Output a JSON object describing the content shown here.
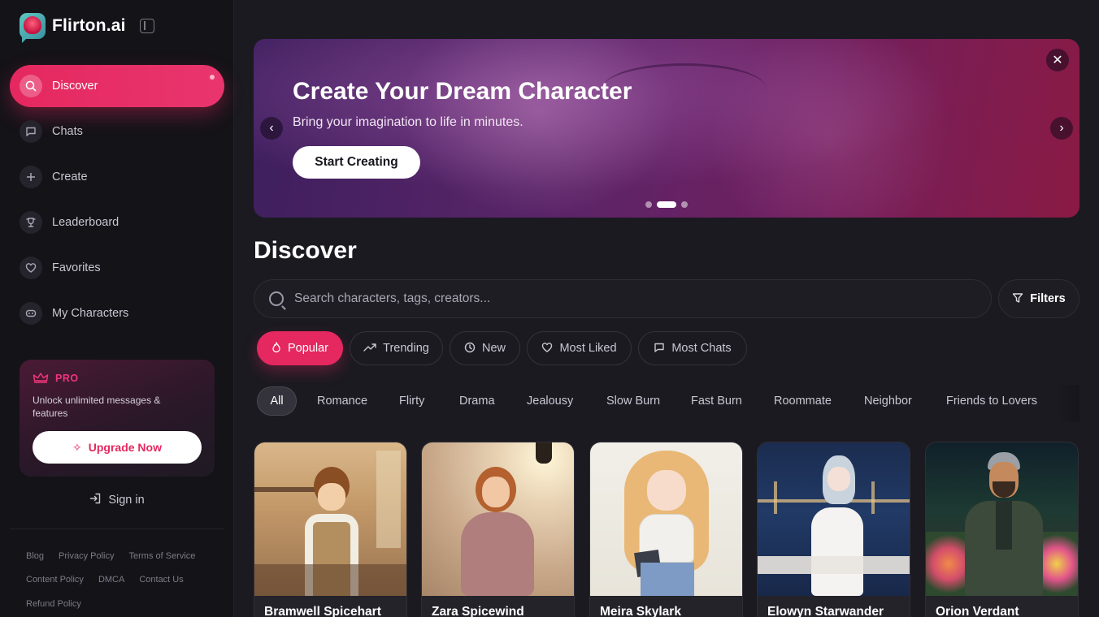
{
  "brand": {
    "name": "Flirton.ai"
  },
  "sidebar": {
    "items": [
      {
        "label": "Discover",
        "icon": "search-icon"
      },
      {
        "label": "Chats",
        "icon": "chat-icon"
      },
      {
        "label": "Create",
        "icon": "plus-icon"
      },
      {
        "label": "Leaderboard",
        "icon": "trophy-icon"
      },
      {
        "label": "Favorites",
        "icon": "heart-icon"
      },
      {
        "label": "My Characters",
        "icon": "mask-icon"
      }
    ],
    "pro": {
      "badge": "PRO",
      "text": "Unlock unlimited messages & features",
      "button": "Upgrade Now"
    },
    "signin": "Sign in",
    "footer_links": [
      [
        "Blog",
        "Privacy Policy",
        "Terms of Service"
      ],
      [
        "Content Policy",
        "DMCA",
        "Contact Us"
      ],
      [
        "Refund Policy"
      ]
    ]
  },
  "hero": {
    "title": "Create Your Dream Character",
    "subtitle": "Bring your imagination to life in minutes.",
    "button": "Start Creating",
    "slides": 3,
    "active_slide": 2
  },
  "discover": {
    "title": "Discover",
    "search_placeholder": "Search characters, tags, creators...",
    "filters_label": "Filters",
    "sort_tabs": [
      {
        "label": "Popular",
        "icon": "flame-icon"
      },
      {
        "label": "Trending",
        "icon": "trending-icon"
      },
      {
        "label": "New",
        "icon": "clock-icon"
      },
      {
        "label": "Most Liked",
        "icon": "heart-icon"
      },
      {
        "label": "Most Chats",
        "icon": "chat-icon"
      }
    ],
    "active_sort": "Popular",
    "tags": [
      "All",
      "Romance",
      "Flirty",
      "Drama",
      "Jealousy",
      "Slow Burn",
      "Fast Burn",
      "Roommate",
      "Neighbor",
      "Friends to Lovers"
    ],
    "active_tag": "All",
    "characters": [
      {
        "name": "Bramwell Spicehart"
      },
      {
        "name": "Zara Spicewind"
      },
      {
        "name": "Meira Skylark"
      },
      {
        "name": "Elowyn Starwander"
      },
      {
        "name": "Orion Verdant"
      }
    ]
  },
  "colors": {
    "accent": "#e5285f",
    "background": "#1b1a21",
    "sidebar": "#141318"
  }
}
